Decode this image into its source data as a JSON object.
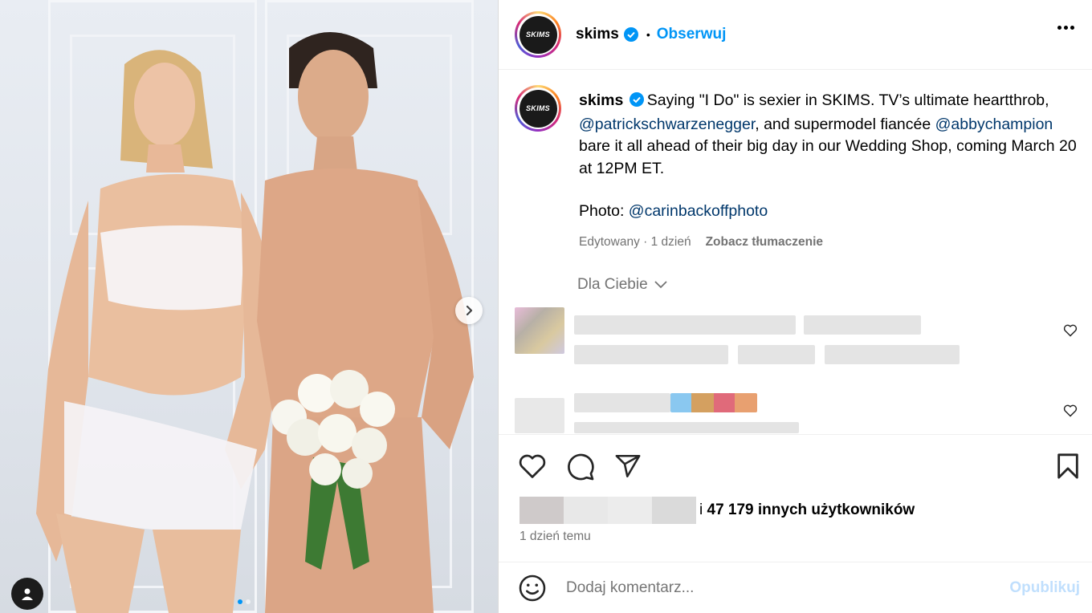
{
  "post": {
    "username": "skims",
    "avatar_text": "SKIMS",
    "follow_label": "Obserwuj",
    "separator": "•"
  },
  "caption": {
    "username": "skims",
    "text_1": "Saying \"I Do\" is sexier in SKIMS. TV’s ultimate heartthrob, ",
    "mention_1": "@patrickschwarzenegger",
    "text_2": ", and supermodel fiancée ",
    "mention_2": "@abbychampion",
    "text_3": " bare it all ahead of their big day in our Wedding Shop, coming March 20 at 12PM ET.",
    "photo_label": "Photo: ",
    "photo_mention": "@carinbackoffphoto",
    "edited": "Edytowany",
    "age": "1 dzień",
    "translate": "Zobacz tłumaczenie"
  },
  "comments_filter": "Dla Ciebie",
  "likes": {
    "suffix_pre": "i",
    "count_text": "47 179 innych użytkowników"
  },
  "timestamp": "1 dzień temu",
  "comment_box": {
    "placeholder": "Dodaj komentarz...",
    "publish": "Opublikuj"
  },
  "carousel": {
    "slides": 2,
    "active_slide": 1
  },
  "colors": {
    "accent": "#0095f6",
    "mention": "#00376b",
    "muted": "#737373"
  },
  "icons": [
    "verified-icon",
    "more-icon",
    "chevron-right-icon",
    "user-tag-icon",
    "heart-icon",
    "comment-icon",
    "share-icon",
    "bookmark-icon",
    "emoji-icon",
    "chevron-down-icon"
  ]
}
